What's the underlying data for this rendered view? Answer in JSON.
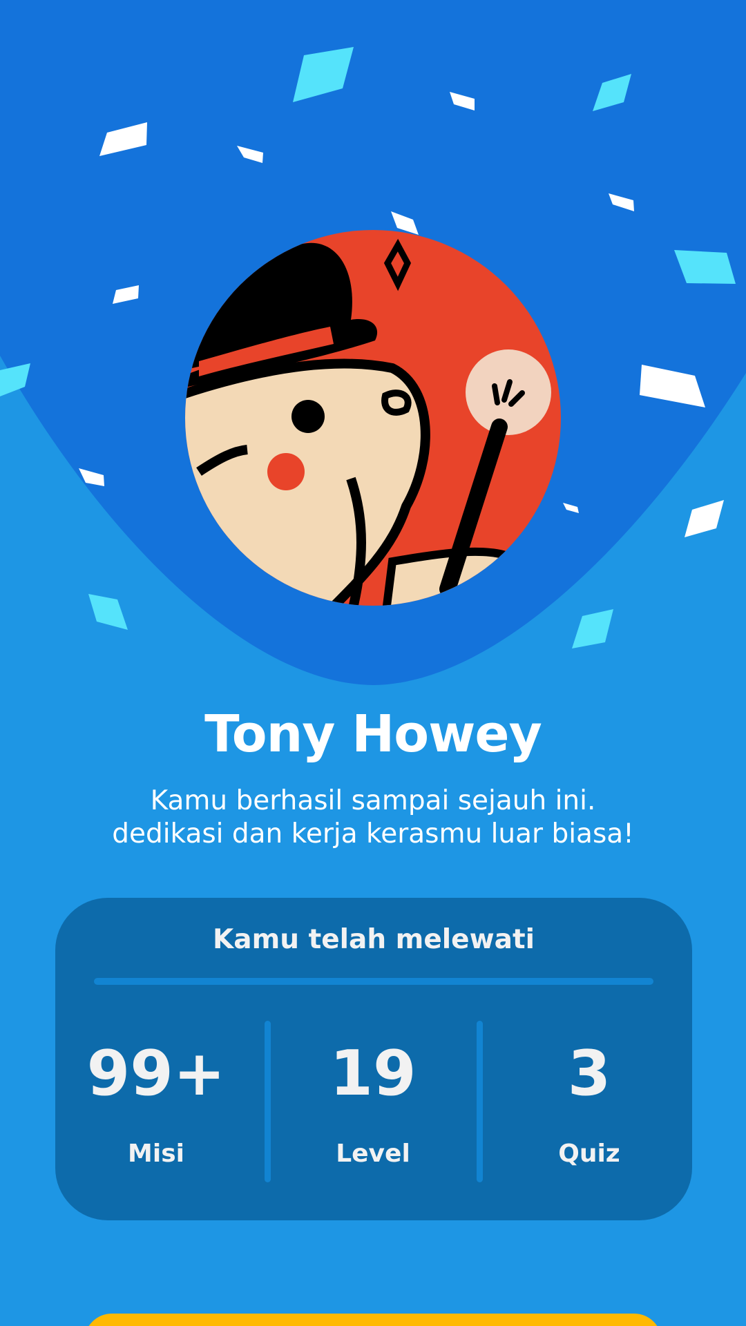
{
  "colors": {
    "background": "#1e96e4",
    "hero_blob": "#1473db",
    "card": "#0d6bab",
    "card_line": "#1284d2",
    "button": "#ffb902",
    "confetti_white": "#ffffff",
    "confetti_cyan": "#55e3fb",
    "avatar_red": "#e8442a",
    "avatar_skin": "#f3d9b6"
  },
  "profile": {
    "avatar_icon": "magician-character-avatar",
    "name": "Tony Howey",
    "message": "Kamu berhasil sampai sejauh ini. dedikasi dan kerja kerasmu luar biasa!"
  },
  "stats": {
    "title": "Kamu telah melewati",
    "items": [
      {
        "value": "99+",
        "label": "Misi"
      },
      {
        "value": "19",
        "label": "Level"
      },
      {
        "value": "3",
        "label": "Quiz"
      }
    ]
  },
  "cta": {
    "label": ""
  }
}
